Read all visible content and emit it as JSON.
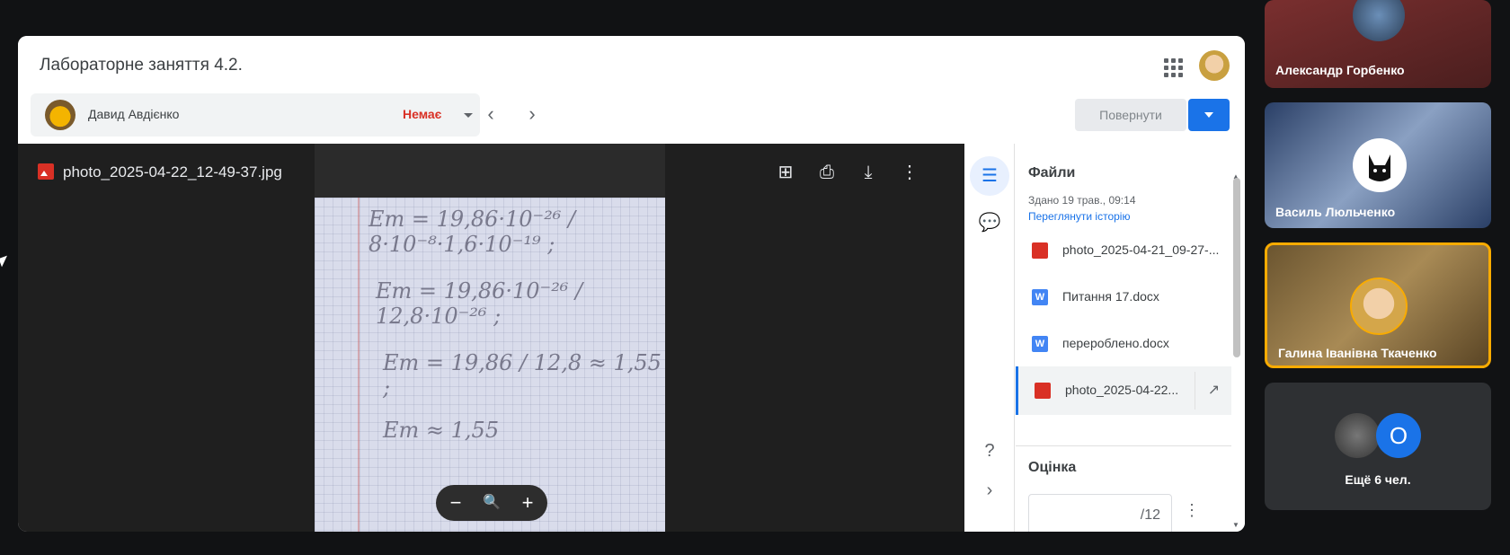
{
  "header": {
    "title": "Лабораторне заняття 4.2.",
    "apps_icon": "apps-grid-icon"
  },
  "student": {
    "name": "Давид Авдієнко",
    "status": "Немає",
    "status_color": "#d93025"
  },
  "actions": {
    "return_label": "Повернути"
  },
  "viewer": {
    "file_name": "photo_2025-04-22_12-49-37.jpg",
    "tools": [
      "add-comment-icon",
      "print-icon",
      "download-icon",
      "more-vert-icon"
    ],
    "photo_lines": [
      "Em = 19,86·10⁻²⁶ / 8·10⁻⁸·1,6·10⁻¹⁹ ;",
      "Em = 19,86·10⁻²⁶ / 12,8·10⁻²⁶ ;",
      "Em = 19,86 / 12,8 ≈ 1,55 ;",
      "Em ≈ 1,55"
    ],
    "zoom": {
      "minus": "−",
      "magnifier": "🔍",
      "plus": "+"
    }
  },
  "panel": {
    "title": "Файли",
    "submitted": "Здано 19 трав., 09:14",
    "history_link": "Переглянути історію",
    "files": [
      {
        "name": "photo_2025-04-21_09-27-...",
        "type": "image"
      },
      {
        "name": "Питання 17.docx",
        "type": "doc"
      },
      {
        "name": "перероблено.docx",
        "type": "doc"
      },
      {
        "name": "photo_2025-04-22...",
        "type": "image",
        "active": true
      }
    ],
    "grade_title": "Оцінка",
    "grade_max": "/12"
  },
  "participants": [
    {
      "name": "Александр Горбенко"
    },
    {
      "name": "Василь Люльченко"
    },
    {
      "name": "Галина Іванівна Ткаченко",
      "highlight_color": "#f9ab00"
    },
    {
      "more_label": "Ещё 6 чел.",
      "initial": "О"
    }
  ],
  "colors": {
    "accent": "#1a73e8",
    "background": "#111214"
  }
}
